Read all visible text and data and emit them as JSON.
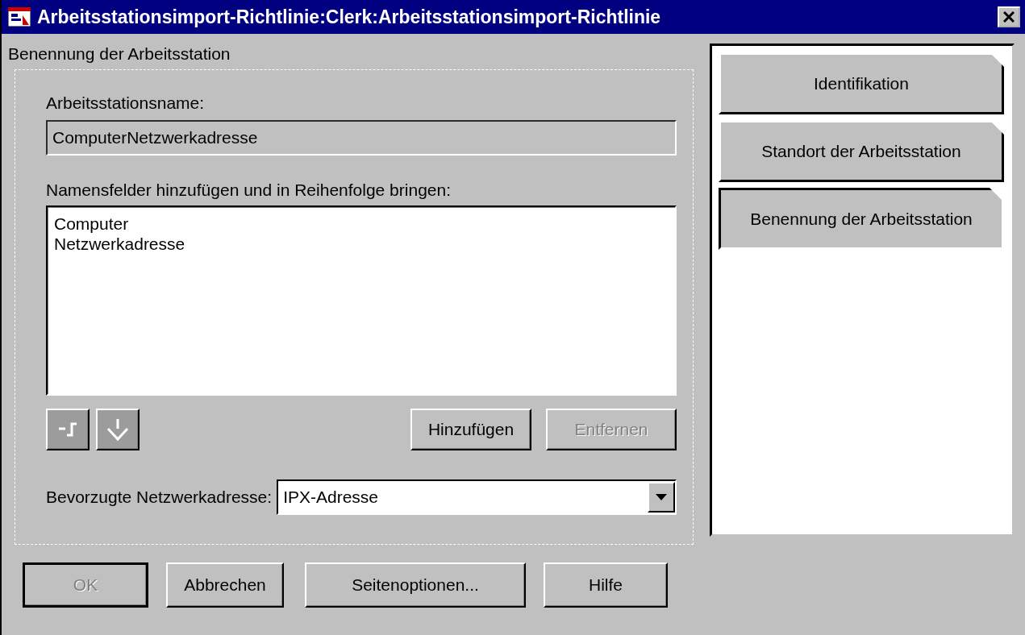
{
  "window": {
    "title": "Arbeitsstationsimport-Richtlinie:Clerk:Arbeitsstationsimport-Richtlinie"
  },
  "section": {
    "title": "Benennung der Arbeitsstation",
    "name_label": "Arbeitsstationsname:",
    "name_field": {
      "value": "ComputerNetzwerkadresse",
      "disabled": true
    },
    "fields_label": "Namensfelder hinzufügen und in Reihenfolge bringen:",
    "fields_list": [
      {
        "label": "Computer",
        "selected": false
      },
      {
        "label": "Netzwerkadresse",
        "selected": false
      }
    ],
    "order_buttons": [
      {
        "kind": "up",
        "disabled": true
      },
      {
        "kind": "down",
        "disabled": true
      }
    ],
    "actions": [
      {
        "label": "Hinzufügen",
        "disabled": false
      },
      {
        "label": "Entfernen",
        "disabled": true
      }
    ],
    "address_label": "Bevorzugte Netzwerkadresse:",
    "address_select": {
      "value": "IPX-Adresse"
    }
  },
  "pages": [
    {
      "label": "Identifikation",
      "selected": false
    },
    {
      "label": "Standort der Arbeitsstation",
      "selected": false
    },
    {
      "label": "Benennung der Arbeitsstation",
      "selected": true
    }
  ],
  "buttons": [
    {
      "label": "OK",
      "disabled": true
    },
    {
      "label": "Abbrechen",
      "disabled": false
    },
    {
      "label": "Seitenoptionen...",
      "disabled": false
    },
    {
      "label": "Hilfe",
      "disabled": false
    }
  ]
}
